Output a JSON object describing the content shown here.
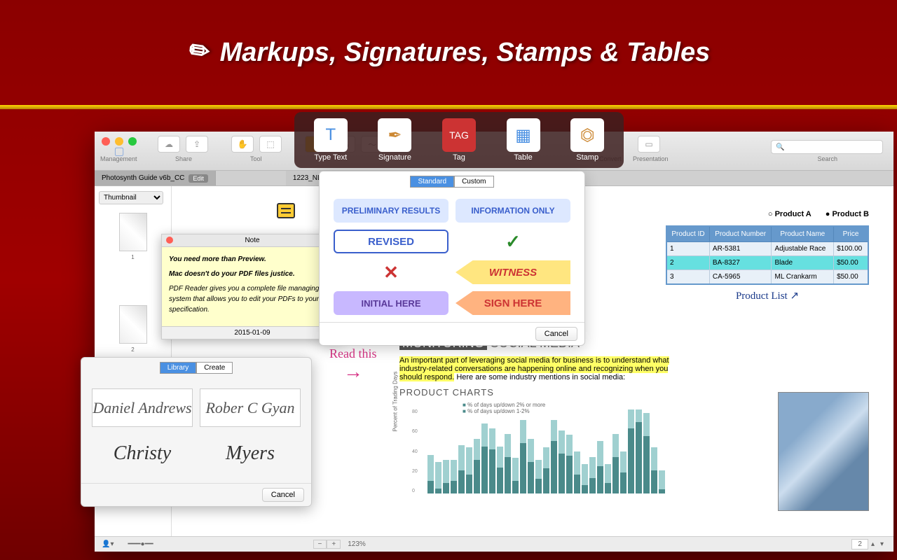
{
  "hero": {
    "title": "Markups, Signatures, Stamps & Tables"
  },
  "features": [
    {
      "label": "Type Text"
    },
    {
      "label": "Signature"
    },
    {
      "label": "Tag"
    },
    {
      "label": "Table"
    },
    {
      "label": "Stamp"
    }
  ],
  "toolbar": {
    "management": "Management",
    "share": "Share",
    "tool": "Tool",
    "typeText": "Type Text",
    "signature": "Signature",
    "tag": "Tag",
    "table": "Table",
    "stamp": "Stamp",
    "convert": "Convert",
    "presentation": "Presentation",
    "search": "Search"
  },
  "tabs": {
    "tab1": "Photosynth Guide v6b_CC",
    "edit": "Edit",
    "tab2": "1223_NL"
  },
  "sidebar": {
    "view": "Thumbnail",
    "page1": "1",
    "page2": "2"
  },
  "stampPanel": {
    "seg1": "Standard",
    "seg2": "Custom",
    "s1": "PRELIMINARY RESULTS",
    "s2": "INFORMATION ONLY",
    "s3": "REVISED",
    "s4": "✓",
    "s5": "✕",
    "s6": "WITNESS",
    "s7": "INITIAL HERE",
    "s8": "SIGN HERE",
    "cancel": "Cancel"
  },
  "note": {
    "title": "Note",
    "p1": "You need more than Preview.",
    "p2": "Mac doesn't do your PDF files justice.",
    "p3": "PDF Reader gives you a complete file managing system that allows you to edit your PDFs to your specification.",
    "date": "2015-01-09"
  },
  "sig": {
    "seg1": "Library",
    "seg2": "Create",
    "s1": "Daniel Andrews",
    "s2": "Rober C Gyan",
    "s3": "Christy",
    "s4": "Myers",
    "cancel": "Cancel"
  },
  "table": {
    "radioA": "Product A",
    "radioB": "Product B",
    "headers": [
      "Product ID",
      "Product Number",
      "Product Name",
      "Price"
    ],
    "rows": [
      [
        "1",
        "AR-5381",
        "Adjustable Race",
        "$100.00"
      ],
      [
        "2",
        "BA-8327",
        "Blade",
        "$50.00"
      ],
      [
        "3",
        "CA-5965",
        "ML Crankarm",
        "$50.00"
      ]
    ],
    "caption": "Product List ↗"
  },
  "annotation": {
    "read": "Read this",
    "arrow": "→"
  },
  "doc": {
    "h1a": "MONITORING",
    "h1b": " SOCIAL MEDIA",
    "hl": "An important part of leveraging social media for business is to understand what industry-related conversations are happening online and recognizing when you should respond.",
    "rest": " Here are some industry mentions in social media:",
    "h2": "PRODUCT CHARTS"
  },
  "status": {
    "zoom": "123%",
    "page": "2"
  },
  "chart_data": {
    "type": "bar",
    "title": "PRODUCT CHARTS",
    "ylabel": "Percent of Trading Days",
    "ylim": [
      0,
      80
    ],
    "y_ticks": [
      0,
      20,
      40,
      60,
      80
    ],
    "legend": [
      "% of days up/down 2% or more",
      "% of days up/down 1-2%"
    ],
    "series": [
      {
        "name": "% of days up/down 2% or more",
        "values": [
          12,
          5,
          10,
          12,
          22,
          18,
          32,
          45,
          42,
          25,
          35,
          12,
          48,
          30,
          14,
          24,
          50,
          38,
          36,
          18,
          8,
          15,
          26,
          10,
          35,
          20,
          62,
          68,
          55,
          22,
          4
        ]
      },
      {
        "name": "% of days up/down 1-2%",
        "values": [
          25,
          25,
          22,
          20,
          24,
          26,
          20,
          22,
          20,
          20,
          22,
          22,
          22,
          22,
          18,
          20,
          20,
          22,
          20,
          22,
          20,
          20,
          24,
          18,
          22,
          20,
          18,
          12,
          22,
          22,
          18
        ]
      }
    ]
  }
}
